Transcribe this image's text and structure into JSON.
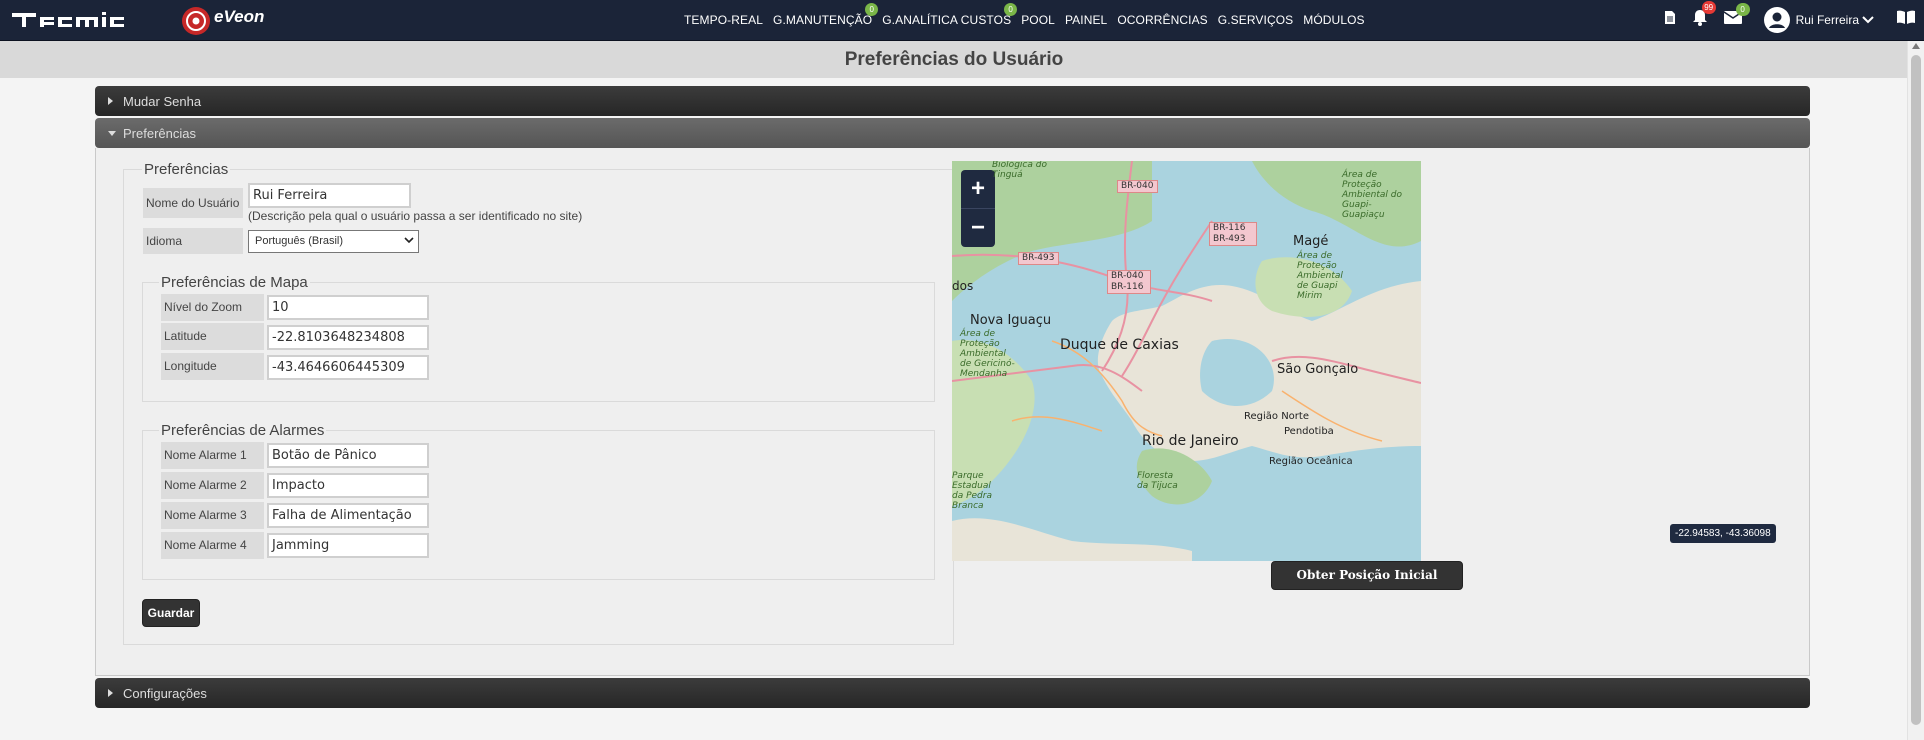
{
  "header": {
    "nav": [
      {
        "label": "TEMPO-REAL",
        "badge": ""
      },
      {
        "label": "G.MANUTENÇÃO",
        "badge": "0"
      },
      {
        "label": "G.ANALÍTICA CUSTOS",
        "badge": "0"
      },
      {
        "label": "POOL",
        "badge": ""
      },
      {
        "label": "PAINEL",
        "badge": ""
      },
      {
        "label": "OCORRÊNCIAS",
        "badge": ""
      },
      {
        "label": "G.SERVIÇOS",
        "badge": ""
      },
      {
        "label": "MÓDULOS",
        "badge": ""
      }
    ],
    "notifications_count": "99",
    "messages_count": "0",
    "user_name": "Rui Ferreira",
    "icons": [
      "document-icon",
      "bell-icon",
      "envelope-icon",
      "user-avatar-icon",
      "chevron-down-icon",
      "book-icon"
    ],
    "colors": {
      "bar": "#1b2438",
      "badge_green": "#7ab648",
      "badge_red": "#e53935"
    }
  },
  "page": {
    "title": "Preferências do Usuário"
  },
  "accordion": {
    "change_password": "Mudar Senha",
    "preferences": "Preferências",
    "configurations": "Configurações"
  },
  "preferences": {
    "legend": "Preferências",
    "username_label": "Nome do Usuário",
    "username_value": "Rui Ferreira",
    "username_hint": "(Descrição pela qual o usuário passa a ser identificado no site)",
    "language_label": "Idioma",
    "language_value": "Português (Brasil)",
    "map": {
      "legend": "Preferências de Mapa",
      "zoom_label": "Nível do Zoom",
      "zoom_value": "10",
      "lat_label": "Latitude",
      "lat_value": "-22.8103648234808",
      "lon_label": "Longitude",
      "lon_value": "-43.4646606445309"
    },
    "alarms": {
      "legend": "Preferências de Alarmes",
      "items": [
        {
          "label": "Nome Alarme 1",
          "value": "Botão de Pânico"
        },
        {
          "label": "Nome Alarme 2",
          "value": "Impacto"
        },
        {
          "label": "Nome Alarme 3",
          "value": "Falha de Alimentação"
        },
        {
          "label": "Nome Alarme 4",
          "value": "Jamming"
        }
      ]
    },
    "save_label": "Guardar"
  },
  "map_widget": {
    "zoom_in": "+",
    "zoom_out": "−",
    "labels": {
      "duque": "Duque de Caxias",
      "rio": "Rio de Janeiro",
      "nova_iguacu": "Nova Iguaçu",
      "sao_goncalo": "São Gonçalo",
      "mage": "Magé",
      "regiao_norte": "Região Norte",
      "pendotiba": "Pendotiba",
      "regiao_oceanica": "Região Oceânica",
      "biologica": "Biológica do Tinguá",
      "floresta": "Floresta da Tijuca",
      "apa_guapi": "Área de Proteção Ambiental do Guapi-Guapiaçu",
      "apa_guapimirim": "Área de Proteção Ambiental de Guapi Mirim",
      "apa_gericino": "Área de Proteção Ambiental de Gericinó-Mendanha",
      "parque": "Parque Estadual da Pedra Branca",
      "dos": "dos"
    },
    "shields": [
      "BR-040",
      "BR-116 BR-493",
      "BR-493",
      "BR-040 BR-116"
    ],
    "get_position_label": "Obter Posição Inicial",
    "coord_tooltip": "-22.94583, -43.36098"
  }
}
